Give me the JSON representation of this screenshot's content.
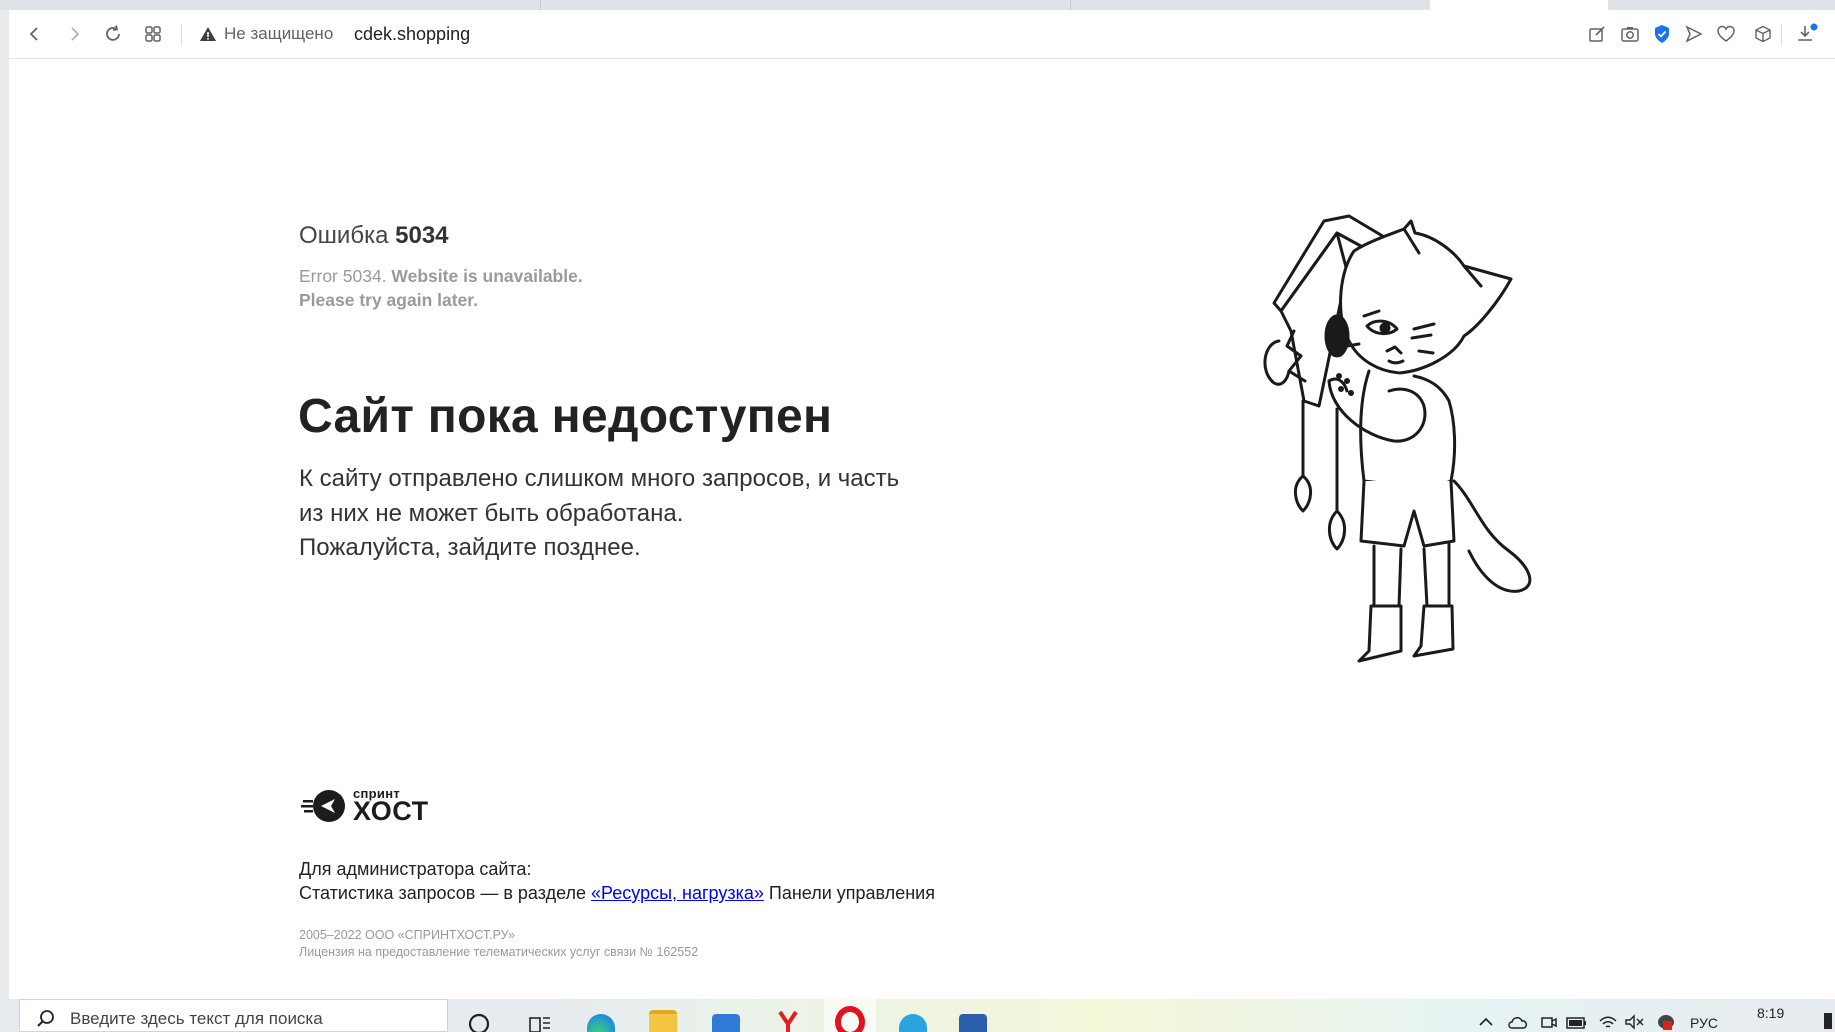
{
  "browser": {
    "security_label": "Не защищено",
    "url": "cdek.shopping"
  },
  "page": {
    "error_prefix": "Ошибка",
    "error_code": "5034",
    "error_en_plain": "Error 5034.",
    "error_en_bold_1": "Website is unavailable.",
    "error_en_bold_2": "Please try again later.",
    "headline": "Сайт пока недоступен",
    "description_lines": [
      "К сайту отправлено слишком много запросов, и часть",
      "из них не может быть обработана.",
      "Пожалуйста, зайдите позднее."
    ],
    "logo_top": "спринт",
    "logo_bottom": "ХОСТ",
    "admin_heading": "Для администратора сайта:",
    "admin_text_before": "Статистика запросов — в разделе",
    "admin_link": "«Ресурсы, нагрузка»",
    "admin_text_after": "Панели управления",
    "copyright": "2005–2022 ООО «СПРИНТХОСТ.РУ»",
    "license": "Лицензия на предоставление телематических услуг связи № 162552"
  },
  "taskbar": {
    "search_placeholder": "Введите здесь текст для поиска",
    "language": "РУС",
    "time": "8:19"
  }
}
